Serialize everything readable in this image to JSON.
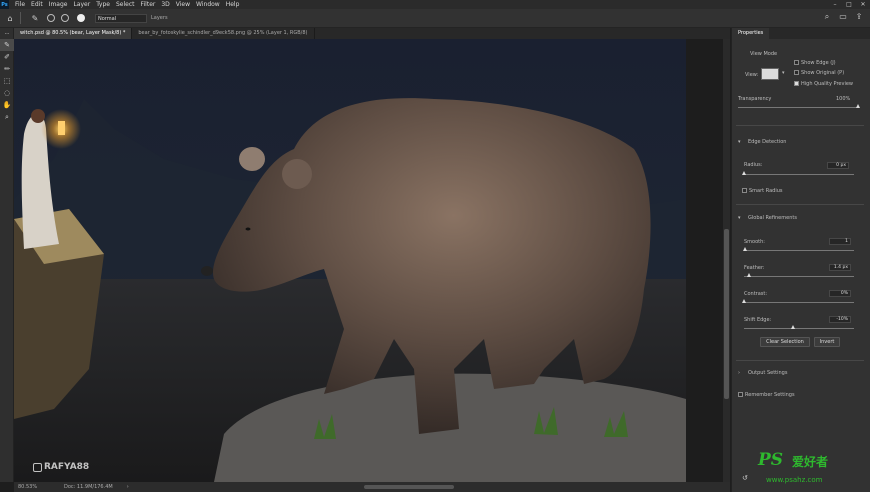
{
  "menubar": {
    "logo": "Ps",
    "items": [
      "File",
      "Edit",
      "Image",
      "Layer",
      "Type",
      "Select",
      "Filter",
      "3D",
      "View",
      "Window",
      "Help"
    ]
  },
  "options_bar": {
    "mode_value": "Normal",
    "layer_label": "Layers"
  },
  "tabs": [
    {
      "label": "witch.psd @ 80.5% (bear, Layer Mask/8) *",
      "active": true
    },
    {
      "label": "bear_by_fotoskylie_schindler_d9eck58.png @ 25% (Layer 1, RGB/8)",
      "active": false
    }
  ],
  "status": {
    "zoom": "80.53%",
    "doc": "Doc: 11.9M/176.4M"
  },
  "properties": {
    "tab_label": "Properties",
    "view_mode_title": "View Mode",
    "view_label": "View:",
    "show_edge": "Show Edge (J)",
    "show_original": "Show Original (P)",
    "high_quality": "High Quality Preview",
    "transparency_label": "Transparency",
    "transparency_value": "100%",
    "transparency_level": 1.0,
    "edge_detection_title": "Edge Detection",
    "radius_label": "Radius:",
    "radius_value": "0 px",
    "radius_level": 0.0,
    "smart_radius": "Smart Radius",
    "global_title": "Global Refinements",
    "smooth_label": "Smooth:",
    "smooth_value": "1",
    "smooth_level": 0.01,
    "feather_label": "Feather:",
    "feather_value": "1.4 px",
    "feather_level": 0.05,
    "contrast_label": "Contrast:",
    "contrast_value": "0%",
    "contrast_level": 0.0,
    "shift_label": "Shift Edge:",
    "shift_value": "-10%",
    "shift_level": 0.45,
    "clear_selection": "Clear Selection",
    "invert": "Invert",
    "output_title": "Output Settings",
    "remember": "Remember Settings"
  },
  "watermark": "RAFYA88",
  "site_logo": {
    "ps": "PS",
    "cn": "爱好者",
    "url": "www.psahz.com"
  }
}
